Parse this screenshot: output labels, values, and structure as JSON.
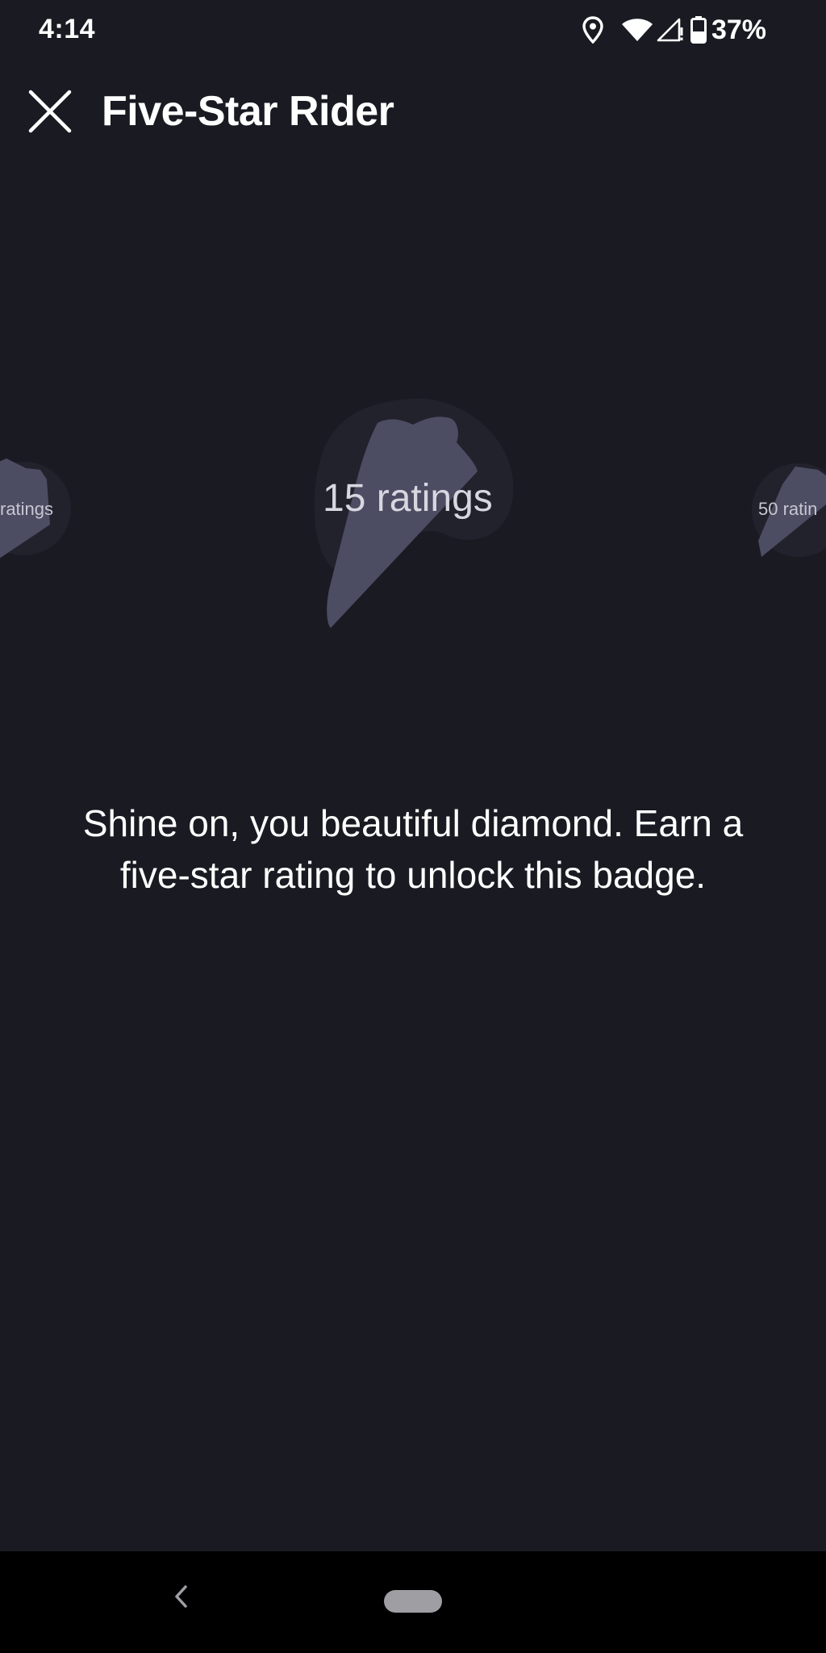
{
  "status_bar": {
    "time": "4:14",
    "battery": "37%",
    "icons": [
      "location-icon",
      "wifi-icon",
      "signal-icon",
      "battery-icon"
    ]
  },
  "header": {
    "title": "Five-Star Rider",
    "close_icon": "close-icon"
  },
  "carousel": {
    "previous_badge_label": "ratings",
    "current_badge_label": "15 ratings",
    "next_badge_label": "50 ratin"
  },
  "description": "Shine on, you beautiful diamond. Earn a five-star rating to unlock this badge.",
  "nav_bar": {
    "back_icon": "back-chevron-icon",
    "home_icon": "home-pill-icon"
  },
  "colors": {
    "background": "#1a1a22",
    "badge_circle": "#22222c",
    "badge_shape": "#4c4c63",
    "nav_background": "#000000"
  }
}
